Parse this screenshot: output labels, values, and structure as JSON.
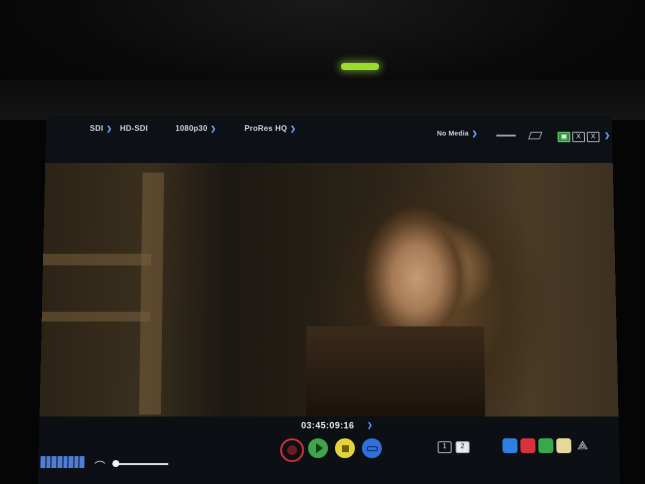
{
  "topbar": {
    "input_type": "SDI",
    "input_standard": "HD-SDI",
    "video_format": "1080p30",
    "codec": "ProRes HQ",
    "media_status": "No Media",
    "monitor_buttons": [
      "X",
      "X"
    ]
  },
  "bottombar": {
    "timecode": "03:45:09:16",
    "page_buttons": [
      "1",
      "2"
    ]
  },
  "colors": {
    "accent_blue": "#6fa8ff",
    "record_red": "#c7323b",
    "play_green": "#3fa447",
    "stop_yellow": "#e5d33a",
    "loop_blue": "#2f6fe0",
    "tally_green": "#9bdc2a"
  },
  "icons": {
    "headphone": "headphone-icon",
    "record": "record-button",
    "play": "play-button",
    "stop": "stop-button",
    "loop": "loop-button"
  }
}
